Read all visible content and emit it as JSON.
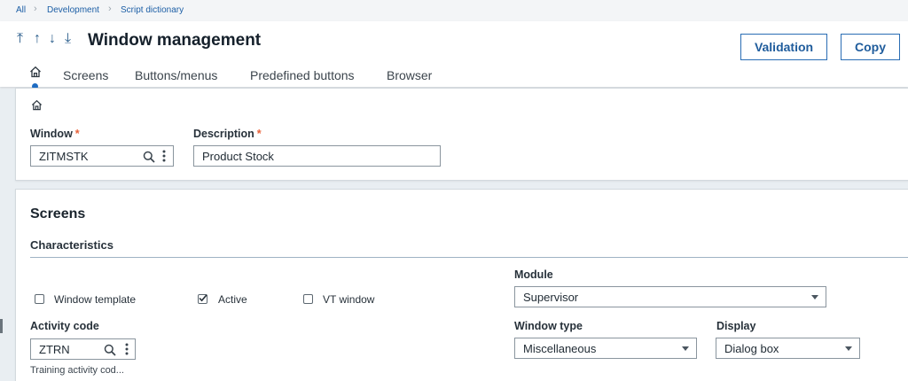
{
  "breadcrumb": {
    "items": [
      "All",
      "Development",
      "Script dictionary"
    ]
  },
  "header": {
    "nav_arrows": [
      "⤒",
      "↑",
      "↓",
      "⤓"
    ],
    "title": "Window management",
    "validation_label": "Validation",
    "copy_label": "Copy"
  },
  "tabs": [
    "Screens",
    "Buttons/menus",
    "Predefined buttons",
    "Browser"
  ],
  "form": {
    "window_label": "Window",
    "window_value": "ZITMSTK",
    "description_label": "Description",
    "description_value": "Product Stock",
    "required_mark": "*"
  },
  "screens": {
    "title": "Screens",
    "characteristics": "Characteristics",
    "window_template_label": "Window template",
    "window_template_checked": false,
    "active_label": "Active",
    "active_checked": true,
    "vt_window_label": "VT window",
    "vt_window_checked": false,
    "module_label": "Module",
    "module_value": "Supervisor",
    "activity_code_label": "Activity code",
    "activity_code_value": "ZTRN",
    "activity_code_desc": "Training activity cod...",
    "window_type_label": "Window type",
    "window_type_value": "Miscellaneous",
    "display_label": "Display",
    "display_value": "Dialog box"
  },
  "colors": {
    "accent": "#1e6cc2",
    "required": "#e8623a",
    "link": "#1d5fa6"
  }
}
